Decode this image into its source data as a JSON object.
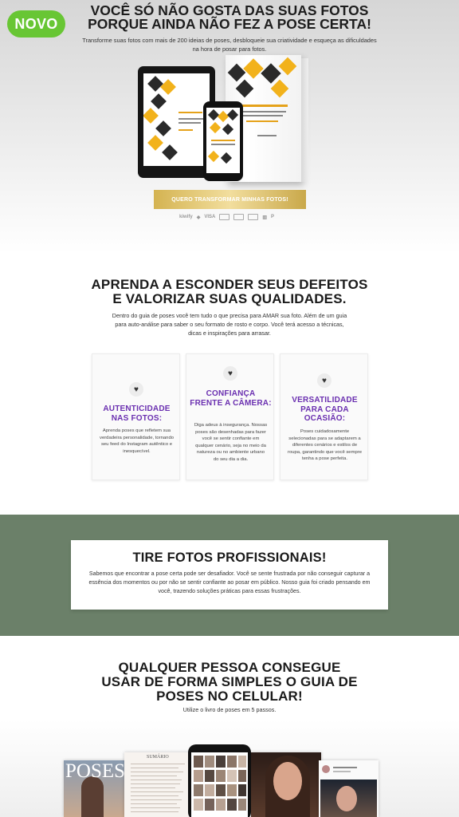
{
  "hero": {
    "badge": "NOVO",
    "title_line1": "VOCÊ SÓ NÃO GOSTA DAS SUAS FOTOS",
    "title_line2": "PORQUE AINDA NÃO FEZ A POSE CERTA!",
    "subtitle": "Transforme suas fotos com mais de 200 ideias de poses, desbloqueie sua criatividade e esqueça as dificuldades na hora de posar para fotos.",
    "cta_label": "QUERO TRANSFORMAR MINHAS FOTOS!",
    "payment": {
      "kiwify": "kiwify",
      "visa": "VISA"
    }
  },
  "section2": {
    "title_line1": "APRENDA A ESCONDER SEUS DEFEITOS",
    "title_line2": "E VALORIZAR SUAS QUALIDADES.",
    "text": "Dentro do guia de poses você tem tudo o que precisa para AMAR sua foto. Além de um guia para auto-análise para saber o seu formato de rosto e corpo. Você terá acesso a técnicas, dicas e inspirações para arrasar.",
    "cards": [
      {
        "title": "AUTENTICIDADE NAS FOTOS:",
        "text": "Aprenda poses que refletem sua verdadeira personalidade, tornando seu feed do Instagram autêntico e inesquecível."
      },
      {
        "title": "CONFIANÇA FRENTE A CÂMERA:",
        "text": "Diga adeus à insegurança. Nossas poses são desenhadas para fazer você se sentir confiante em qualquer cenário, seja no meio da natureza ou no ambiente urbano do seu dia a dia."
      },
      {
        "title": "VERSATILIDADE PARA CADA OCASIÃO:",
        "text": "Poses cuidadosamente selecionadas para se adaptarem a diferentes cenários e estilos de roupa, garantindo que você sempre tenha a pose perfeita."
      }
    ]
  },
  "section3": {
    "title": "TIRE FOTOS PROFISSIONAIS!",
    "text": "Sabemos que encontrar a pose certa pode ser desafiador. Você se sente frustrada por não conseguir capturar a essência dos momentos ou por não se sentir confiante ao posar em público. Nosso guia foi criado pensando em você, trazendo soluções práticas para essas frustrações."
  },
  "section4": {
    "title_line1": "QUALQUER PESSOA CONSEGUE",
    "title_line2": "USAR DE FORMA SIMPLES O GUIA DE",
    "title_line3": "POSES NO CELULAR!",
    "subtitle": "Utilize o livro de poses em 5 passos.",
    "mag_title": "POSES",
    "summary_title": "SUMÁRIO"
  },
  "colors": {
    "accent_green": "#68c634",
    "title_purple": "#6a2fb0",
    "band_green": "#6b8069",
    "gold": "#d4b351"
  }
}
